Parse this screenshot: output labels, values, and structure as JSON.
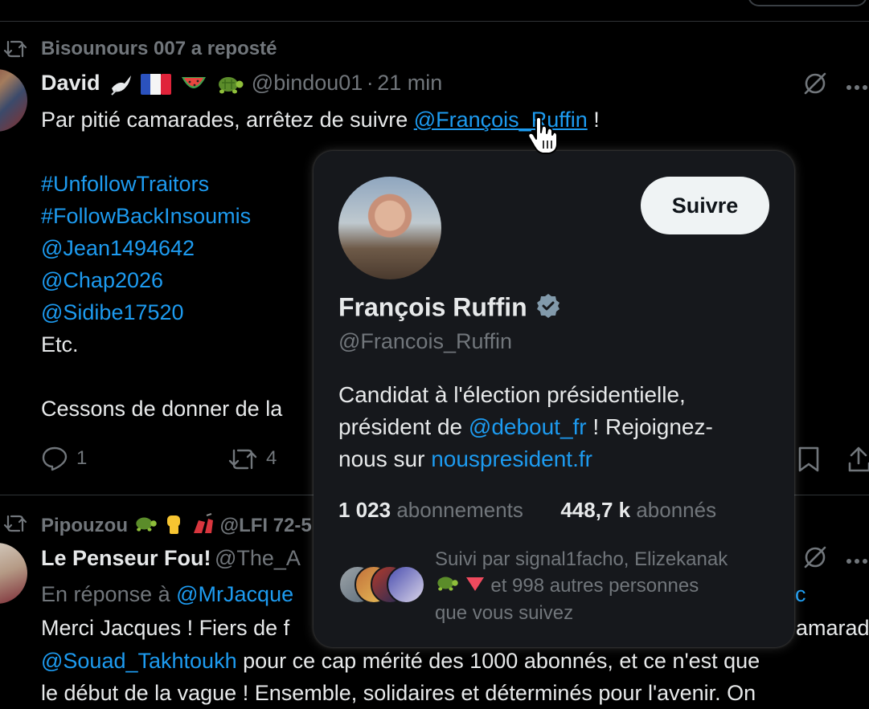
{
  "post1": {
    "reposted_by": "Bisounours 007 a reposté",
    "name": "David",
    "handle": "@bindou01",
    "time_sep": "·",
    "time": "21 min",
    "text_prefix": "Par pitié camarades, arrêtez de suivre",
    "mention": "@François_Ruffin",
    "text_suffix": "!",
    "lines": [
      "#UnfollowTraitors",
      "#FollowBackInsoumis",
      "@Jean1494642",
      "@Chap2026",
      "@Sidibe17520"
    ],
    "etc": "Etc.",
    "truncated": "Cessons de donner de la",
    "replies": "1",
    "reposts": "4"
  },
  "post2": {
    "reposted_by": "Pipouzou",
    "reposted_by_handle": "@LFI 72-5",
    "name": "Le Penseur Fou!",
    "handle": "@The_A",
    "reply_prefix": "En réponse à",
    "reply_to": "@MrJacque",
    "reply_tail": "c",
    "line1_start": "Merci Jacques ! Fiers de f",
    "line1_end": "amarade",
    "line2_mention": "@Souad_Takhtoukh",
    "line2_rest": "pour ce cap mérité des 1000 abonnés, et ce n'est que",
    "line3": "le début de la vague ! Ensemble, solidaires et déterminés pour l'avenir. On"
  },
  "card": {
    "follow_label": "Suivre",
    "name": "François Ruffin",
    "handle": "@Francois_Ruffin",
    "bio_line1": "Candidat à l'élection présidentielle,",
    "bio_line2_prefix": "président de",
    "bio_line2_mention": "@debout_fr",
    "bio_line2_suffix": "! Rejoignez-",
    "bio_line3_prefix": "nous sur",
    "bio_line3_link": "nouspresident.fr",
    "following_count": "1 023",
    "following_label": "abonnements",
    "followers_count": "448,7 k",
    "followers_label": "abonnés",
    "followed_by_line1": "Suivi par signal1facho, Elizekanak",
    "followed_by_line2": "et 998 autres personnes",
    "followed_by_line3": "que vous suivez"
  },
  "colors": {
    "background": "#000000",
    "card": "#16181c",
    "link": "#1d9bf0",
    "muted": "#71767b",
    "verified": "#829aab"
  }
}
